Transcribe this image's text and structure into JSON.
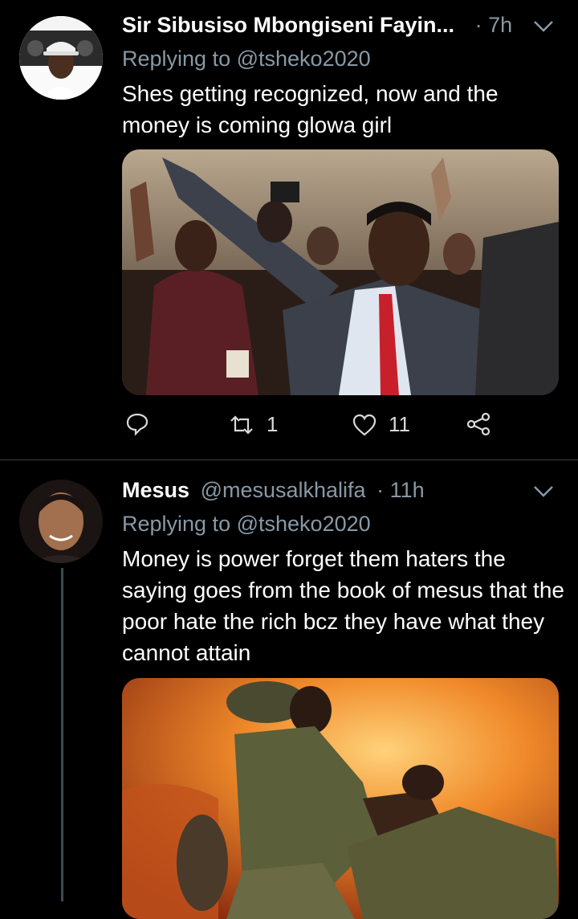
{
  "tweets": [
    {
      "name": "Sir Sibusiso Mbongiseni Fayin...",
      "handle": "",
      "time": "· 7h",
      "reply_prefix": "Replying to",
      "reply_to": "@tsheko2020",
      "text": "Shes getting recognized, now and the money is coming glowa girl",
      "actions": {
        "retweets": "1",
        "likes": "11"
      }
    },
    {
      "name": "Mesus",
      "handle": "@mesusalkhalifa",
      "time": "· 11h",
      "reply_prefix": "Replying to",
      "reply_to": "@tsheko2020",
      "text": "Money is power forget them haters the saying goes from the book of mesus that the poor hate the rich bcz they have what they cannot attain"
    }
  ],
  "colors": {
    "background": "#000000",
    "secondary_text": "#8899a6",
    "divider": "#38444d"
  }
}
